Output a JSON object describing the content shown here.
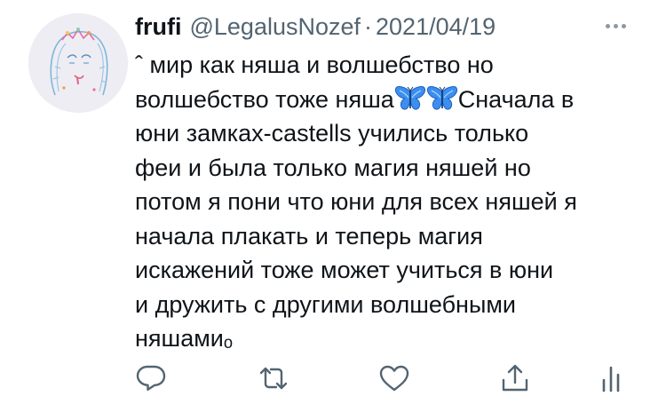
{
  "tweet": {
    "display_name": "frufi",
    "handle": "@LegalusNozef",
    "separator": "·",
    "date": "2021/04/19",
    "body": {
      "line1": "ˆ мир как няша и волшебство но",
      "line2_before": "волшебство тоже няша",
      "line2_after": "Сначала в",
      "line3": "юни замках-castells учились только",
      "line4": "феи и была только магия няшей но",
      "line5": "потом я пони что юни для всех няшей я",
      "line6": "начала плакать и теперь магия",
      "line7": "искажений тоже может учиться в юни",
      "line8": "и дружить с другими волшебными",
      "line9": "няшамиₒ"
    },
    "emoji": [
      "butterfly",
      "butterfly"
    ]
  },
  "icons": {
    "more": "more-horizontal-icon",
    "reply": "reply-icon",
    "retweet": "retweet-icon",
    "like": "heart-icon",
    "share": "share-icon",
    "analytics": "analytics-icon"
  },
  "colors": {
    "text": "#0f1419",
    "secondary": "#536471",
    "icon": "#536471",
    "butterfly": "#3b8ff0"
  }
}
